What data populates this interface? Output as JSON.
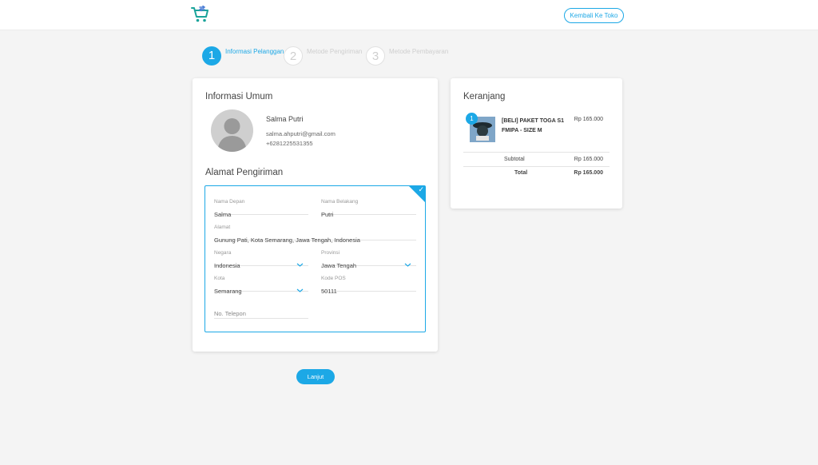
{
  "header": {
    "logo_icon": "cart-arrows-icon",
    "back_button_label": "Kembali Ke Toko"
  },
  "steps": [
    {
      "number": "1",
      "label": "Informasi Pelanggan",
      "active": true
    },
    {
      "number": "2",
      "label": "Metode Pengiriman",
      "active": false
    },
    {
      "number": "3",
      "label": "Metode Pembayaran",
      "active": false
    }
  ],
  "general_info": {
    "title": "Informasi Umum",
    "name": "Salma Putri",
    "email": "salma.ahputri@gmail.com",
    "phone": "+6281225531355"
  },
  "shipping": {
    "title": "Alamat Pengiriman",
    "first_name": {
      "label": "Nama Depan",
      "value": "Salma"
    },
    "last_name": {
      "label": "Nama Belakang",
      "value": "Putri"
    },
    "address": {
      "label": "Alamat",
      "value": "Gunung Pati, Kota Semarang, Jawa Tengah, Indonesia"
    },
    "country": {
      "label": "Negara",
      "value": "Indonesia"
    },
    "province": {
      "label": "Provinsi",
      "value": "Jawa Tengah"
    },
    "city": {
      "label": "Kota",
      "value": "Semarang"
    },
    "postal_code": {
      "label": "Kode POS",
      "value": "50111"
    },
    "phone": {
      "placeholder": "No. Telepon"
    }
  },
  "cart": {
    "title": "Keranjang",
    "items": [
      {
        "qty": "1",
        "name": "[BELI] PAKET TOGA S1 FMIPA - SIZE M",
        "price": "Rp 165.000"
      }
    ],
    "subtotal_label": "Subtotal",
    "subtotal_value": "Rp 165.000",
    "total_label": "Total",
    "total_value": "Rp 165.000"
  },
  "next_button_label": "Lanjut",
  "colors": {
    "accent": "#1ca8e6",
    "background": "#f4f4f4"
  }
}
